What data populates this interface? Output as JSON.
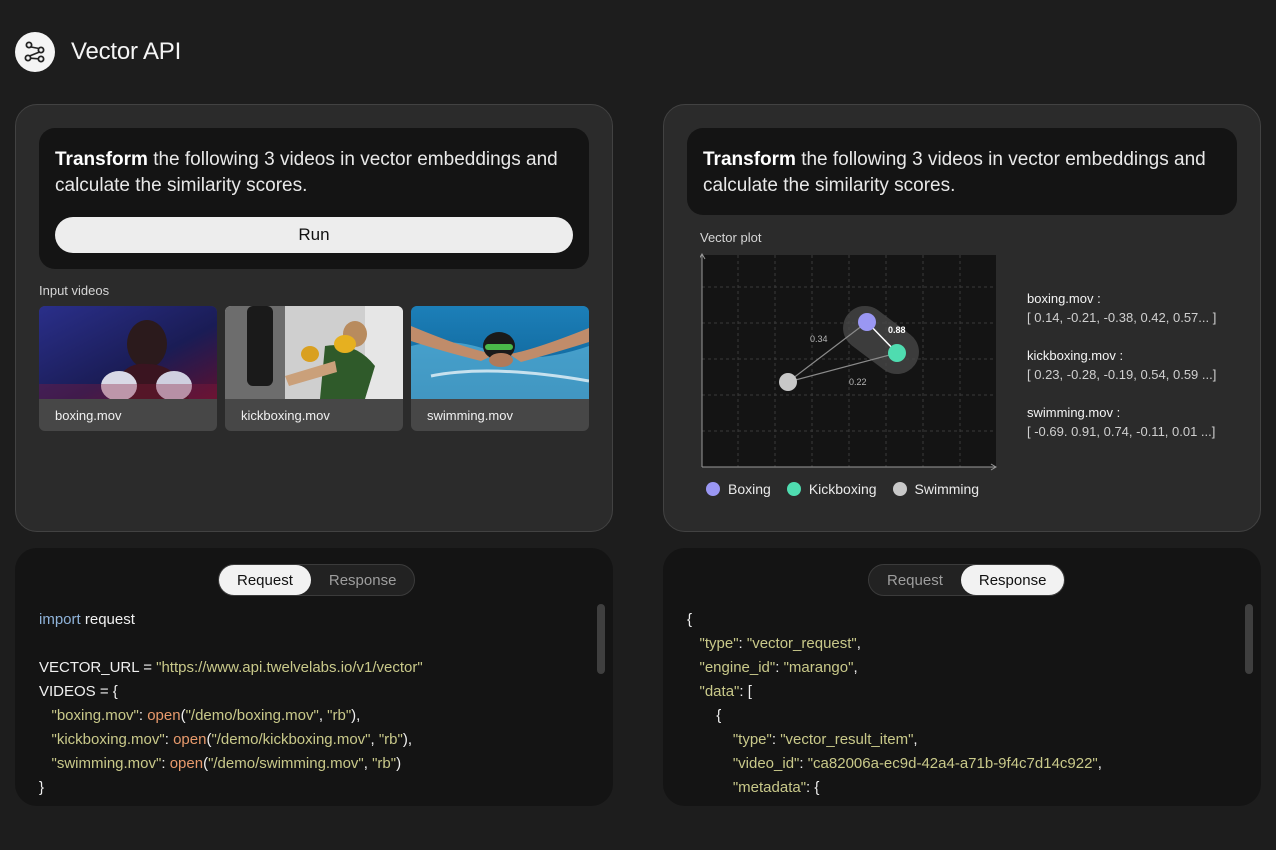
{
  "app": {
    "title": "Vector API",
    "logo_icon": "vector-nodes-icon"
  },
  "left_panel": {
    "prompt": {
      "bold": "Transform",
      "rest": " the following 3 videos in vector embeddings and calculate the similarity scores."
    },
    "run_label": "Run",
    "input_label": "Input videos",
    "videos": [
      {
        "name": "boxing.mov"
      },
      {
        "name": "kickboxing.mov"
      },
      {
        "name": "swimming.mov"
      }
    ]
  },
  "right_panel": {
    "prompt": {
      "bold": "Transform",
      "rest": " the following 3 videos in vector embeddings and calculate the similarity scores."
    },
    "plot_label": "Vector plot",
    "plot": {
      "edges": [
        {
          "label": "0.88"
        },
        {
          "label": "0.34"
        },
        {
          "label": "0.22"
        }
      ]
    },
    "vectors": [
      {
        "name": "boxing.mov :",
        "values": "[ 0.14, -0.21, -0.38, 0.42, 0.57... ]"
      },
      {
        "name": "kickboxing.mov :",
        "values": "[ 0.23, -0.28, -0.19, 0.54, 0.59 ...]"
      },
      {
        "name": "swimming.mov :",
        "values": "[ -0.69. 0.91, 0.74, -0.11, 0.01 ...]"
      }
    ],
    "legend": [
      {
        "label": "Boxing",
        "color": "#9a97f3"
      },
      {
        "label": "Kickboxing",
        "color": "#4fdcb0"
      },
      {
        "label": "Swimming",
        "color": "#c8c8c8"
      }
    ]
  },
  "request_panel": {
    "tabs": [
      "Request",
      "Response"
    ],
    "active_tab": "Request",
    "code": {
      "l1_kw": "import",
      "l1_rest": " request",
      "l3_a": "VECTOR_URL = ",
      "l3_str": "\"https://www.api.twelvelabs.io/v1/vector\"",
      "l4": "VIDEOS = {",
      "l5_key": "\"boxing.mov\"",
      "l5_path": "\"/demo/boxing.mov\"",
      "l6_key": "\"kickboxing.mov\"",
      "l6_path": "\"/demo/kickboxing.mov\"",
      "l7_key": "\"swimming.mov\"",
      "l7_path": "\"/demo/swimming.mov\"",
      "fn": "open",
      "mode": "\"rb\"",
      "l8": "}"
    }
  },
  "response_panel": {
    "tabs": [
      "Request",
      "Response"
    ],
    "active_tab": "Response",
    "code": {
      "l1": "{",
      "type_key": "\"type\"",
      "type_val": "\"vector_request\"",
      "engine_key": "\"engine_id\"",
      "engine_val": "\"marango\"",
      "data_key": "\"data\"",
      "inner_open": "{",
      "item_type_val": "\"vector_result_item\"",
      "video_key": "\"video_id\"",
      "video_val": "\"ca82006a-ec9d-42a4-a71b-9f4c7d14c922\"",
      "meta_key": "\"metadata\""
    }
  }
}
